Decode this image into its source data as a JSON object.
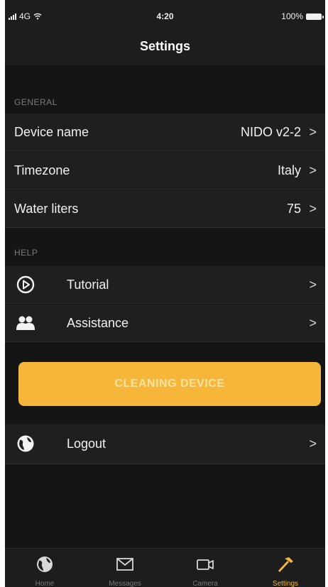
{
  "status_bar": {
    "carrier": "4G",
    "time": "4:20",
    "battery": "100%"
  },
  "header": {
    "title": "Settings"
  },
  "general": {
    "section_label": "GENERAL",
    "rows": [
      {
        "label": "Device name",
        "value": "NIDO v2-2"
      },
      {
        "label": "Timezone",
        "value": "Italy"
      },
      {
        "label": "Water liters",
        "value": "75"
      }
    ]
  },
  "help": {
    "section_label": "HELP",
    "rows": [
      {
        "label": "Tutorial",
        "icon": "play-circle-icon"
      },
      {
        "label": "Assistance",
        "icon": "people-icon"
      }
    ]
  },
  "cta": {
    "label": "CLEANING DEVICE",
    "color": "#f5b63a"
  },
  "logout": {
    "label": "Logout",
    "icon": "globe-icon"
  },
  "chevron": ">",
  "tabbar": {
    "tabs": [
      {
        "label": "Home",
        "icon": "globe-icon"
      },
      {
        "label": "Messages",
        "icon": "envelope-icon"
      },
      {
        "label": "Camera",
        "icon": "video-camera-icon"
      },
      {
        "label": "Settings",
        "icon": "hammer-icon",
        "active": true
      }
    ],
    "active_color": "#f5b63a"
  }
}
